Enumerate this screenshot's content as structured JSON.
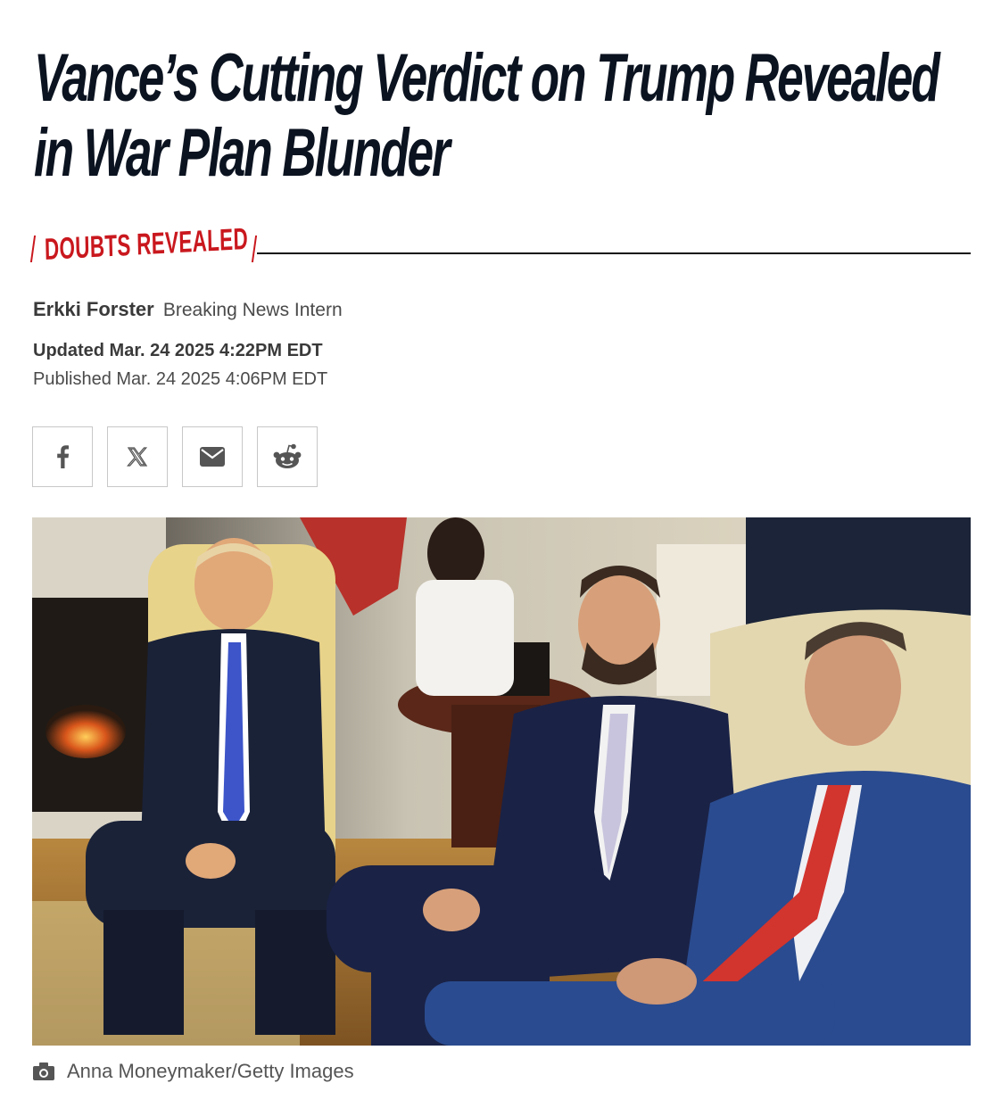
{
  "article": {
    "headline": "Vance’s Cutting Verdict on Trump Revealed in War Plan Blunder",
    "rubric": "DOUBTS REVEALED",
    "author_name": "Erkki Forster",
    "author_role": "Breaking News Intern",
    "updated": "Updated Mar. 24 2025 4:22PM EDT",
    "published": "Published Mar. 24 2025 4:06PM EDT"
  },
  "share": [
    {
      "network": "facebook",
      "icon": "facebook-icon"
    },
    {
      "network": "x",
      "icon": "x-icon"
    },
    {
      "network": "email",
      "icon": "mail-icon"
    },
    {
      "network": "reddit",
      "icon": "reddit-icon"
    }
  ],
  "photo": {
    "credit": "Anna Moneymaker/Getty Images",
    "credit_icon": "camera-icon"
  },
  "colors": {
    "accent_red": "#c9181e",
    "headline": "#0b1320"
  }
}
